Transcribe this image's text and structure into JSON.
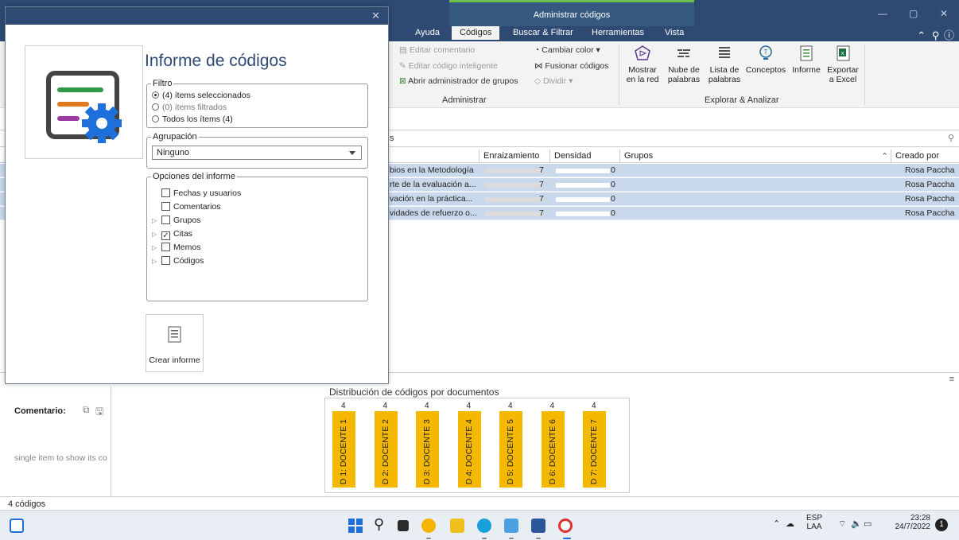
{
  "window": {
    "context_title": "Administrar códigos",
    "tabs": [
      "Ayuda",
      "Códigos",
      "Buscar & Filtrar",
      "Herramientas",
      "Vista"
    ],
    "active_tab": "Códigos"
  },
  "ribbon": {
    "edit_comment": "Editar comentario",
    "edit_smart_code": "Editar código inteligente",
    "open_group_manager": "Abrir administrador de grupos",
    "change_color": "Cambiar color ▾",
    "merge_codes": "Fusionar códigos",
    "split": "Dividir ▾",
    "group_administrar": "Administrar",
    "show_network_l1": "Mostrar",
    "show_network_l2": "en la red",
    "word_cloud_l1": "Nube de",
    "word_cloud_l2": "palabras",
    "word_list_l1": "Lista de",
    "word_list_l2": "palabras",
    "concepts": "Conceptos",
    "report": "Informe",
    "export_l1": "Exportar",
    "export_l2": "a Excel",
    "group_explore": "Explorar & Analizar"
  },
  "search": {
    "text": "s"
  },
  "table": {
    "headers": [
      "Enraizamiento",
      "Densidad",
      "Grupos",
      "Creado por"
    ],
    "rows": [
      {
        "name": "bios en la Metodología",
        "root": "7",
        "density": "0",
        "author": "Rosa Paccha"
      },
      {
        "name": "rte de la evaluación a...",
        "root": "7",
        "density": "0",
        "author": "Rosa Paccha"
      },
      {
        "name": "vación en la práctica...",
        "root": "7",
        "density": "0",
        "author": "Rosa Paccha"
      },
      {
        "name": "vidades de refuerzo o...",
        "root": "7",
        "density": "0",
        "author": "Rosa Paccha"
      }
    ]
  },
  "comment_pane": {
    "label": "Comentario:",
    "hint": "single item to show its co"
  },
  "chart_data": {
    "type": "bar",
    "title": "Distribución de códigos por documentos",
    "categories": [
      "D 1: DOCENTE 1",
      "D 2: DOCENTE 2",
      "D 3: DOCENTE 3",
      "D 4: DOCENTE 4",
      "D 5: DOCENTE 5",
      "D 6: DOCENTE 6",
      "D 7: DOCENTE 7"
    ],
    "values": [
      4,
      4,
      4,
      4,
      4,
      4,
      4
    ],
    "color": "#f5b800"
  },
  "status": {
    "count": "4 códigos"
  },
  "dialog": {
    "title": "Informe de códigos",
    "filter_legend": "Filtro",
    "filter_options": [
      "(4) ítems seleccionados",
      "(0) ítems filtrados",
      "Todos los ítems (4)"
    ],
    "grouping_legend": "Agrupación",
    "grouping_value": "Ninguno",
    "report_options_legend": "Opciones del informe",
    "report_options": [
      {
        "label": "Fechas y usuarios",
        "checked": false,
        "expandable": false
      },
      {
        "label": "Comentarios",
        "checked": false,
        "expandable": false
      },
      {
        "label": "Grupos",
        "checked": false,
        "expandable": true
      },
      {
        "label": "Citas",
        "checked": true,
        "expandable": true
      },
      {
        "label": "Memos",
        "checked": false,
        "expandable": true
      },
      {
        "label": "Códigos",
        "checked": false,
        "expandable": true
      }
    ],
    "create_button": "Crear informe"
  },
  "taskbar": {
    "lang_l1": "ESP",
    "lang_l2": "LAA",
    "time": "23:28",
    "date": "24/7/2022",
    "notif_count": "1"
  },
  "colors": {
    "titlebar": "#2e4a73",
    "selection": "#c9d8ea",
    "chart_bar": "#f5b800",
    "accent_green": "#6cc04a"
  }
}
